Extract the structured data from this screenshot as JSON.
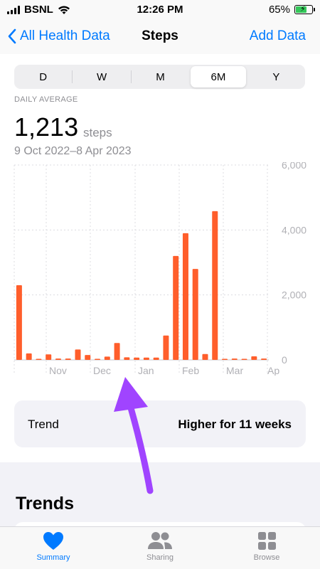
{
  "status": {
    "carrier": "BSNL",
    "time": "12:26 PM",
    "battery": "65%"
  },
  "nav": {
    "back_label": "All Health Data",
    "title": "Steps",
    "add_label": "Add Data"
  },
  "range_tabs": [
    "D",
    "W",
    "M",
    "6M",
    "Y"
  ],
  "selected_range": "6M",
  "summary": {
    "label": "DAILY AVERAGE",
    "value": "1,213",
    "unit": "steps",
    "date_range": "9 Oct 2022–8 Apr 2023"
  },
  "chart_data": {
    "type": "bar",
    "x_tick_labels": [
      "Nov",
      "Dec",
      "Jan",
      "Feb",
      "Mar",
      "Ap"
    ],
    "y_tick_labels": [
      "6,000",
      "4,000",
      "2,000",
      "0"
    ],
    "ylim": [
      0,
      6000
    ],
    "y_axis_side": "right",
    "grid": true,
    "bar_color": "#ff5e2b",
    "values": [
      2300,
      200,
      30,
      170,
      40,
      40,
      320,
      150,
      20,
      100,
      520,
      80,
      70,
      70,
      70,
      750,
      3200,
      3900,
      2800,
      180,
      4580,
      20,
      40,
      20,
      110,
      40
    ]
  },
  "trend": {
    "label": "Trend",
    "value": "Higher for 11 weeks"
  },
  "trends_heading": "Trends",
  "tabs": [
    {
      "label": "Summary",
      "icon": "heart-icon",
      "active": true
    },
    {
      "label": "Sharing",
      "icon": "people-icon",
      "active": false
    },
    {
      "label": "Browse",
      "icon": "grid-icon",
      "active": false
    }
  ],
  "colors": {
    "accent": "#007aff",
    "annotation_arrow": "#a044ff"
  }
}
